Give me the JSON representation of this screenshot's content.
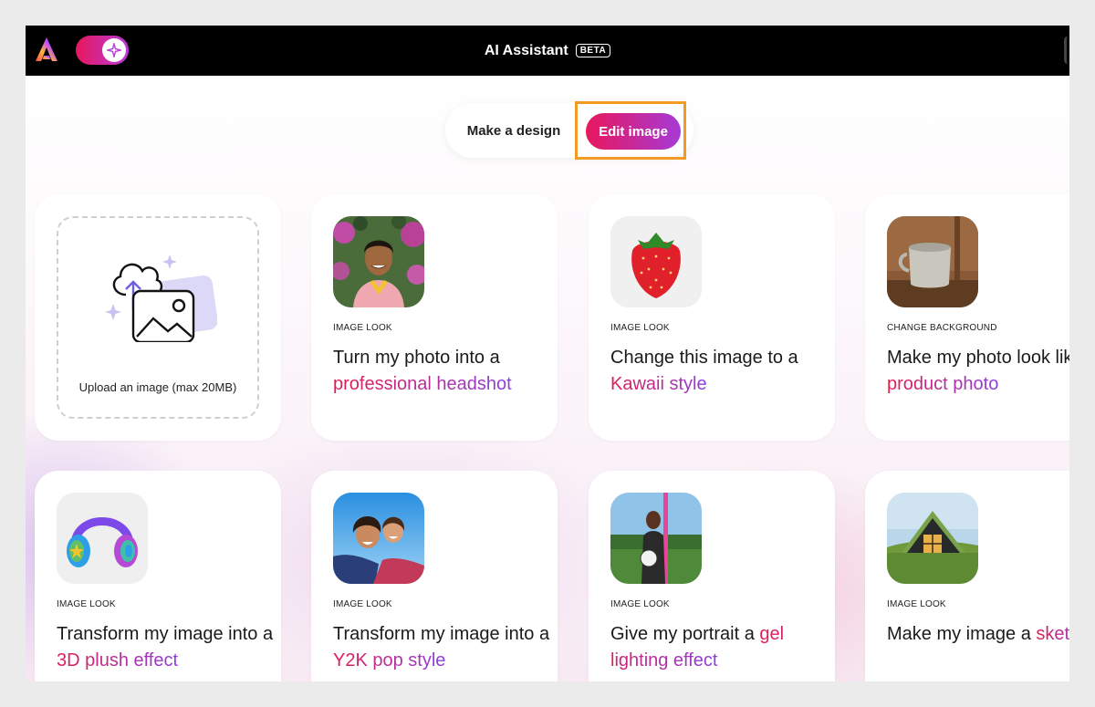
{
  "header": {
    "title": "AI Assistant",
    "badge": "BETA"
  },
  "mode_switch": {
    "make_design": "Make a design",
    "edit_image": "Edit image",
    "selected": "Edit image"
  },
  "upload": {
    "label": "Upload an image (max 20MB)"
  },
  "cards": [
    {
      "thumbnail": "smiling-man-headshot",
      "category": "IMAGE LOOK",
      "text_before": "Turn my photo into a ",
      "highlight": "professional headshot",
      "text_after": ""
    },
    {
      "thumbnail": "strawberry",
      "category": "IMAGE LOOK",
      "text_before": "Change this image to a ",
      "highlight": "Kawaii style",
      "text_after": ""
    },
    {
      "thumbnail": "ceramic-mug",
      "category": "CHANGE BACKGROUND",
      "text_before": "Make my photo look like a ",
      "highlight": "product photo",
      "text_after": ""
    },
    {
      "thumbnail": "headphones",
      "category": "IMAGE LOOK",
      "text_before": "Transform my image into a ",
      "highlight": "3D plush effect",
      "text_after": ""
    },
    {
      "thumbnail": "two-friends-selfie",
      "category": "IMAGE LOOK",
      "text_before": "Transform my image into a ",
      "highlight": "Y2K pop style",
      "text_after": ""
    },
    {
      "thumbnail": "soccer-player",
      "category": "IMAGE LOOK",
      "text_before": "Give my portrait a ",
      "highlight": "gel lighting effect",
      "text_after": ""
    },
    {
      "thumbnail": "grass-roof-cabin",
      "category": "IMAGE LOOK",
      "text_before": "Make my image a ",
      "highlight": "sketch",
      "text_after": ""
    }
  ],
  "colors": {
    "accent_start": "#e8175d",
    "accent_end": "#a63ad6",
    "highlight_box": "#f39a24",
    "topbar": "#000000"
  }
}
